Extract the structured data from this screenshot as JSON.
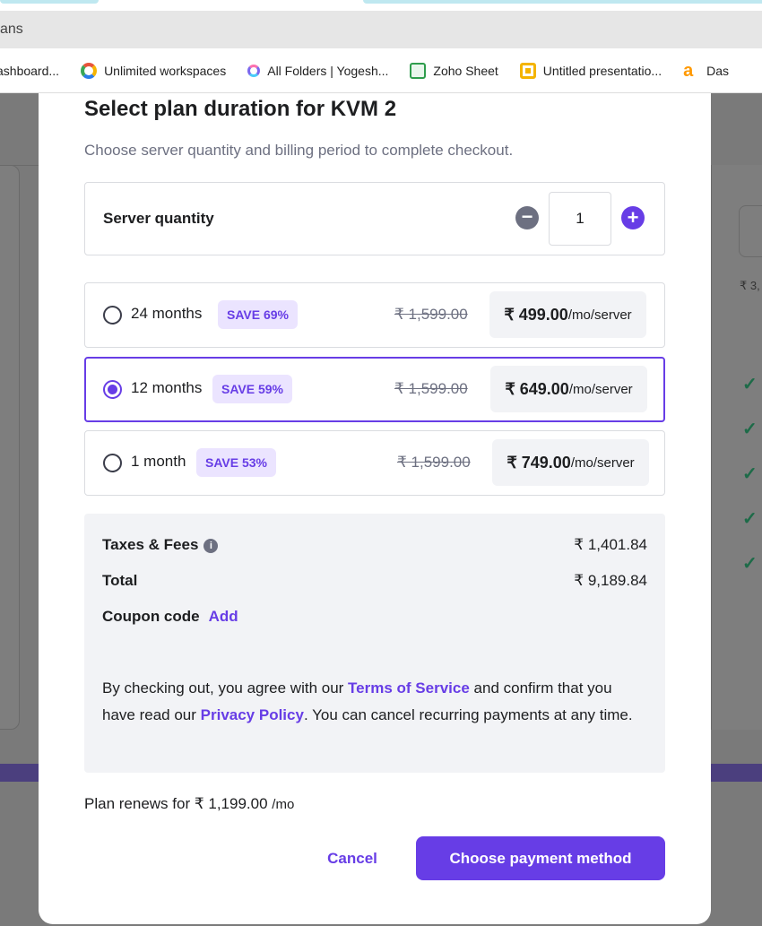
{
  "browser": {
    "address_text": "ans",
    "bookmarks": [
      {
        "label": "ashboard...",
        "icon": "dashboard-icon"
      },
      {
        "label": "Unlimited workspaces",
        "icon": "circle-logo-icon"
      },
      {
        "label": "All Folders | Yogesh...",
        "icon": "clickup-icon"
      },
      {
        "label": "Zoho Sheet",
        "icon": "zoho-sheet-icon"
      },
      {
        "label": "Untitled presentatio...",
        "icon": "slides-icon"
      },
      {
        "label": "Das",
        "icon": "amazon-icon"
      }
    ]
  },
  "background": {
    "price_fragment": "₹ 3,"
  },
  "modal": {
    "title": "Select plan duration for KVM 2",
    "subtitle": "Choose server quantity and billing period to complete checkout.",
    "quantity": {
      "label": "Server quantity",
      "value": "1",
      "minus": "−",
      "plus": "+"
    },
    "plans": [
      {
        "duration": "24 months",
        "save": "SAVE 69%",
        "old_price": "₹ 1,599.00",
        "price": "₹ 499.00",
        "unit": "/mo/server",
        "selected": false
      },
      {
        "duration": "12 months",
        "save": "SAVE 59%",
        "old_price": "₹ 1,599.00",
        "price": "₹ 649.00",
        "unit": "/mo/server",
        "selected": true
      },
      {
        "duration": "1 month",
        "save": "SAVE 53%",
        "old_price": "₹ 1,599.00",
        "price": "₹ 749.00",
        "unit": "/mo/server",
        "selected": false
      }
    ],
    "summary": {
      "taxes_label": "Taxes & Fees",
      "taxes_value": "₹ 1,401.84",
      "total_label": "Total",
      "total_value": "₹ 9,189.84",
      "coupon_label": "Coupon code",
      "coupon_action": "Add",
      "legal_prefix": "By checking out, you agree with our ",
      "terms_link": "Terms of Service",
      "legal_mid": " and confirm that you have read our ",
      "privacy_link": "Privacy Policy",
      "legal_suffix": ". You can cancel recurring payments at any time."
    },
    "renew": {
      "text": "Plan renews for ₹ 1,199.00",
      "unit": "/mo"
    },
    "buttons": {
      "cancel": "Cancel",
      "choose_payment": "Choose payment method"
    }
  },
  "colors": {
    "accent": "#673de6",
    "badge_bg": "#ebe4ff",
    "summary_bg": "#f2f3f6"
  }
}
